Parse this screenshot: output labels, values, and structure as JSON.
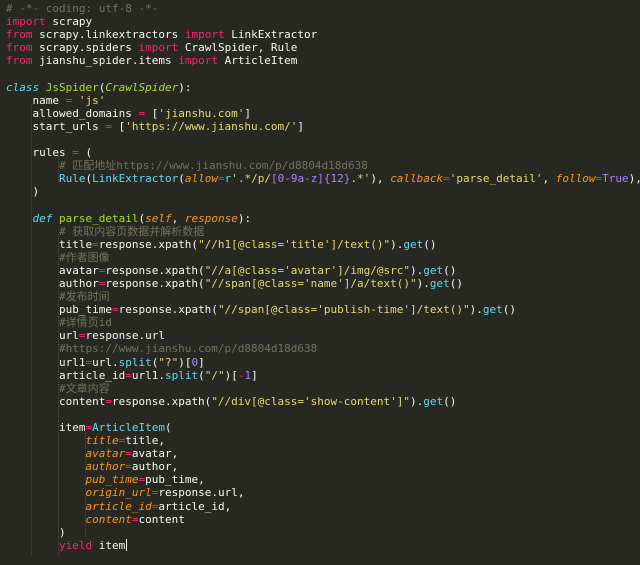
{
  "colors": {
    "background": "#272822",
    "default": "#f8f8f2",
    "keyword": "#f92672",
    "string": "#e6db74",
    "comment": "#75715e",
    "function": "#a6e22e",
    "parameter": "#fd971f",
    "number": "#ae81ff",
    "storage": "#66d9ef"
  },
  "editor": {
    "lines": [
      [
        [
          "comment",
          "# -*- coding: utf-8 -*-"
        ]
      ],
      [
        [
          "keyword",
          "import"
        ],
        [
          "default",
          " scrapy"
        ]
      ],
      [
        [
          "keyword",
          "from"
        ],
        [
          "default",
          " scrapy.linkextractors "
        ],
        [
          "keyword",
          "import"
        ],
        [
          "default",
          " LinkExtractor"
        ]
      ],
      [
        [
          "keyword",
          "from"
        ],
        [
          "default",
          " scrapy.spiders "
        ],
        [
          "keyword",
          "import"
        ],
        [
          "default",
          " CrawlSpider, Rule"
        ]
      ],
      [
        [
          "keyword",
          "from"
        ],
        [
          "default",
          " jianshu_spider.items "
        ],
        [
          "keyword",
          "import"
        ],
        [
          "default",
          " ArticleItem"
        ]
      ],
      [],
      [
        [
          "storage",
          "class"
        ],
        [
          "default",
          " "
        ],
        [
          "function",
          "JsSpider"
        ],
        [
          "default",
          "("
        ],
        [
          "function",
          "CrawlSpider"
        ],
        [
          "default",
          "):"
        ]
      ],
      [
        [
          "default",
          "    name "
        ],
        [
          "keyword",
          "="
        ],
        [
          "default",
          " "
        ],
        [
          "string",
          "'js'"
        ]
      ],
      [
        [
          "default",
          "    allowed_domains "
        ],
        [
          "keyword",
          "="
        ],
        [
          "default",
          " ["
        ],
        [
          "string",
          "'jianshu.com'"
        ],
        [
          "default",
          "]"
        ]
      ],
      [
        [
          "default",
          "    start_urls "
        ],
        [
          "keyword",
          "="
        ],
        [
          "default",
          " ["
        ],
        [
          "string",
          "'https://www.jianshu.com/'"
        ],
        [
          "default",
          "]"
        ]
      ],
      [],
      [
        [
          "default",
          "    rules "
        ],
        [
          "keyword",
          "="
        ],
        [
          "default",
          " ("
        ]
      ],
      [
        [
          "comment",
          "        # 匹配地址https://www.jianshu.com/p/d8804d18d638"
        ]
      ],
      [
        [
          "default",
          "        "
        ],
        [
          "storage",
          "Rule"
        ],
        [
          "default",
          "("
        ],
        [
          "storage",
          "LinkExtractor"
        ],
        [
          "default",
          "("
        ],
        [
          "parameter",
          "allow"
        ],
        [
          "keyword",
          "="
        ],
        [
          "storage",
          "r"
        ],
        [
          "string",
          "'.*/p/"
        ],
        [
          "number",
          "[0-9a-z]{12}"
        ],
        [
          "string",
          ".*'"
        ],
        [
          "default",
          "), "
        ],
        [
          "parameter",
          "callback"
        ],
        [
          "keyword",
          "="
        ],
        [
          "string",
          "'parse_detail'"
        ],
        [
          "default",
          ", "
        ],
        [
          "parameter",
          "follow"
        ],
        [
          "keyword",
          "="
        ],
        [
          "number",
          "True"
        ],
        [
          "default",
          "),"
        ]
      ],
      [
        [
          "default",
          "    )"
        ]
      ],
      [],
      [
        [
          "storage",
          "    def"
        ],
        [
          "default",
          " "
        ],
        [
          "function",
          "parse_detail"
        ],
        [
          "default",
          "("
        ],
        [
          "parameter",
          "self"
        ],
        [
          "default",
          ", "
        ],
        [
          "parameter",
          "response"
        ],
        [
          "default",
          "):"
        ]
      ],
      [
        [
          "comment",
          "        # 获取内容页数据并解析数据"
        ]
      ],
      [
        [
          "default",
          "        title"
        ],
        [
          "keyword",
          "="
        ],
        [
          "default",
          "response.xpath("
        ],
        [
          "string",
          "\"//h1[@class='title']/text()\""
        ],
        [
          "default",
          ")."
        ],
        [
          "storage",
          "get"
        ],
        [
          "default",
          "()"
        ]
      ],
      [
        [
          "comment",
          "        #作者图像"
        ]
      ],
      [
        [
          "default",
          "        avatar"
        ],
        [
          "keyword",
          "="
        ],
        [
          "default",
          "response.xpath("
        ],
        [
          "string",
          "\"//a[@class='avatar']/img/@src\""
        ],
        [
          "default",
          ")."
        ],
        [
          "storage",
          "get"
        ],
        [
          "default",
          "()"
        ]
      ],
      [
        [
          "default",
          "        author"
        ],
        [
          "keyword",
          "="
        ],
        [
          "default",
          "response.xpath("
        ],
        [
          "string",
          "\"//span[@class='name']/a/text()\""
        ],
        [
          "default",
          ")."
        ],
        [
          "storage",
          "get"
        ],
        [
          "default",
          "()"
        ]
      ],
      [
        [
          "comment",
          "        #发布时间"
        ]
      ],
      [
        [
          "default",
          "        pub_time"
        ],
        [
          "keyword",
          "="
        ],
        [
          "default",
          "response.xpath("
        ],
        [
          "string",
          "\"//span[@class='publish-time']/text()\""
        ],
        [
          "default",
          ")."
        ],
        [
          "storage",
          "get"
        ],
        [
          "default",
          "()"
        ]
      ],
      [
        [
          "comment",
          "        #详情页id"
        ]
      ],
      [
        [
          "default",
          "        url"
        ],
        [
          "keyword",
          "="
        ],
        [
          "default",
          "response.url"
        ]
      ],
      [
        [
          "comment",
          "        #https://www.jianshu.com/p/d8804d18d638"
        ]
      ],
      [
        [
          "default",
          "        url1"
        ],
        [
          "keyword",
          "="
        ],
        [
          "default",
          "url."
        ],
        [
          "storage",
          "split"
        ],
        [
          "default",
          "("
        ],
        [
          "string",
          "\"?\""
        ],
        [
          "default",
          ")["
        ],
        [
          "number",
          "0"
        ],
        [
          "default",
          "]"
        ]
      ],
      [
        [
          "default",
          "        article_id"
        ],
        [
          "keyword",
          "="
        ],
        [
          "default",
          "url1."
        ],
        [
          "storage",
          "split"
        ],
        [
          "default",
          "("
        ],
        [
          "string",
          "\"/\""
        ],
        [
          "default",
          ")["
        ],
        [
          "keyword",
          "-"
        ],
        [
          "number",
          "1"
        ],
        [
          "default",
          "]"
        ]
      ],
      [
        [
          "comment",
          "        #文章内容"
        ]
      ],
      [
        [
          "default",
          "        content"
        ],
        [
          "keyword",
          "="
        ],
        [
          "default",
          "response.xpath("
        ],
        [
          "string",
          "\"//div[@class='show-content']\""
        ],
        [
          "default",
          ")."
        ],
        [
          "storage",
          "get"
        ],
        [
          "default",
          "()"
        ]
      ],
      [],
      [
        [
          "default",
          "        item"
        ],
        [
          "keyword",
          "="
        ],
        [
          "storage",
          "ArticleItem"
        ],
        [
          "default",
          "("
        ]
      ],
      [
        [
          "default",
          "            "
        ],
        [
          "parameter",
          "title"
        ],
        [
          "keyword",
          "="
        ],
        [
          "default",
          "title,"
        ]
      ],
      [
        [
          "default",
          "            "
        ],
        [
          "parameter",
          "avatar"
        ],
        [
          "keyword",
          "="
        ],
        [
          "default",
          "avatar,"
        ]
      ],
      [
        [
          "default",
          "            "
        ],
        [
          "parameter",
          "author"
        ],
        [
          "keyword",
          "="
        ],
        [
          "default",
          "author,"
        ]
      ],
      [
        [
          "default",
          "            "
        ],
        [
          "parameter",
          "pub_time"
        ],
        [
          "keyword",
          "="
        ],
        [
          "default",
          "pub_time,"
        ]
      ],
      [
        [
          "default",
          "            "
        ],
        [
          "parameter",
          "origin_url"
        ],
        [
          "keyword",
          "="
        ],
        [
          "default",
          "response.url,"
        ]
      ],
      [
        [
          "default",
          "            "
        ],
        [
          "parameter",
          "article_id"
        ],
        [
          "keyword",
          "="
        ],
        [
          "default",
          "article_id,"
        ]
      ],
      [
        [
          "default",
          "            "
        ],
        [
          "parameter",
          "content"
        ],
        [
          "keyword",
          "="
        ],
        [
          "default",
          "content"
        ]
      ],
      [
        [
          "default",
          "        )"
        ]
      ],
      [
        [
          "keyword",
          "        yield"
        ],
        [
          "default",
          " item"
        ]
      ]
    ]
  }
}
